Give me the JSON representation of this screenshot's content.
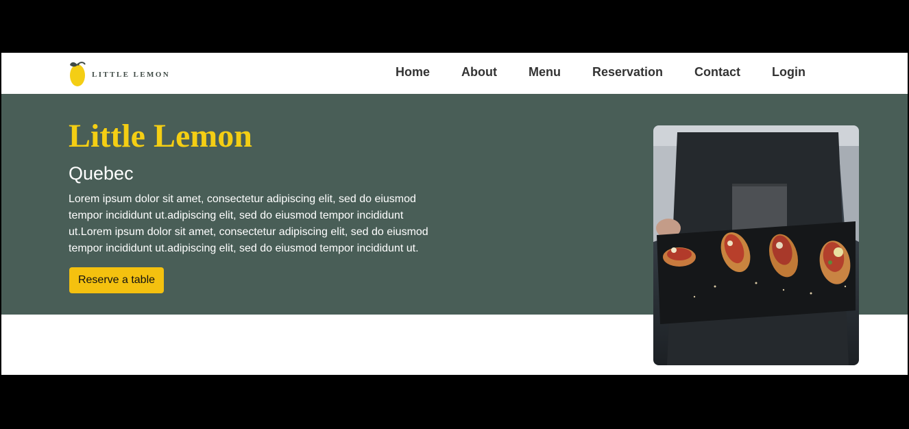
{
  "brand": {
    "logo_text": "LITTLE LEMON",
    "logo_icon": "lemon-icon",
    "colors": {
      "green": "#495e57",
      "yellow": "#f4ce14",
      "button": "#f4c10f"
    }
  },
  "nav": {
    "items": [
      {
        "label": "Home"
      },
      {
        "label": "About"
      },
      {
        "label": "Menu"
      },
      {
        "label": "Reservation"
      },
      {
        "label": "Contact"
      },
      {
        "label": "Login"
      }
    ]
  },
  "hero": {
    "title": "Little Lemon",
    "subtitle": "Quebec",
    "description": "Lorem ipsum dolor sit amet, consectetur adipiscing elit, sed do eiusmod tempor incididunt ut.adipiscing elit, sed do eiusmod tempor incididunt ut.Lorem ipsum dolor sit amet, consectetur adipiscing elit, sed do eiusmod tempor incididunt ut.adipiscing elit, sed do eiusmod tempor incididunt ut.",
    "cta_label": "Reserve a table",
    "image_subject": "chef-serving-bruschetta-photo"
  }
}
